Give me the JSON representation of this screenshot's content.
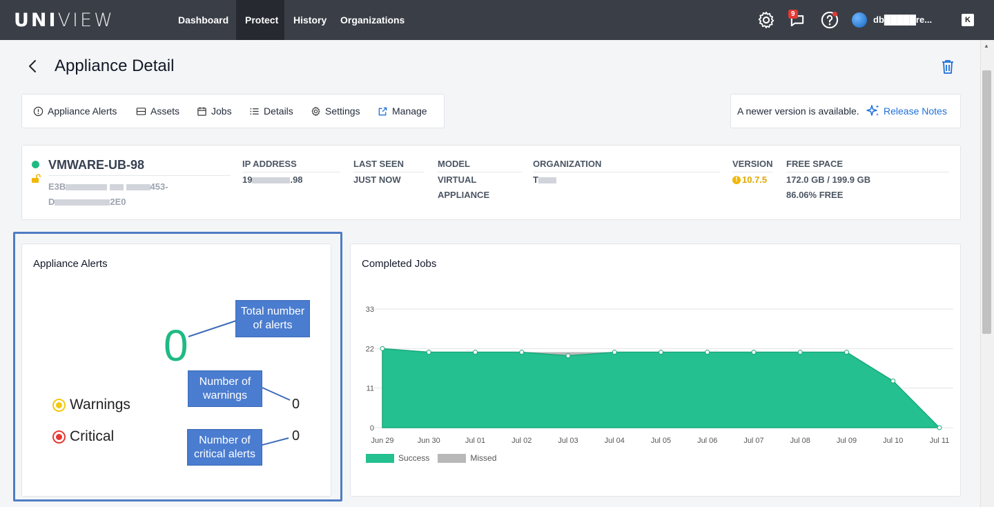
{
  "nav": {
    "logo_bold": "UNI",
    "logo_light": "VIEW",
    "items": [
      "Dashboard",
      "Protect",
      "History",
      "Organizations"
    ],
    "active": "Protect",
    "notifications_count": "9",
    "user": "db█████re..."
  },
  "page": {
    "title": "Appliance Detail"
  },
  "tabs": [
    "Appliance Alerts",
    "Assets",
    "Jobs",
    "Details",
    "Settings",
    "Manage"
  ],
  "release": {
    "text": "A newer version is available.",
    "link": "Release Notes"
  },
  "appliance": {
    "name": "VMWARE-UB-98",
    "id_line1_a": "E3B",
    "id_line1_b": "453-",
    "id_line2_a": "D",
    "id_line2_b": "2E0",
    "ip_label": "IP ADDRESS",
    "ip_a": "19",
    "ip_b": ".98",
    "last_seen_label": "LAST SEEN",
    "last_seen": "JUST NOW",
    "model_label": "MODEL",
    "model_1": "VIRTUAL",
    "model_2": "APPLIANCE",
    "org_label": "ORGANIZATION",
    "org": "T",
    "version_label": "VERSION",
    "version": "10.7.5",
    "free_label": "FREE SPACE",
    "free_1": "172.0 GB / 199.9 GB",
    "free_2": "86.06% FREE"
  },
  "alerts": {
    "title": "Appliance Alerts",
    "total": "0",
    "warnings_label": "Warnings",
    "warnings": "0",
    "critical_label": "Critical",
    "critical": "0",
    "callout_total": "Total number of alerts",
    "callout_warnings": "Number of warnings",
    "callout_critical": "Number of critical alerts",
    "colors": {
      "total": "#1fba83",
      "warning": "#f2c811",
      "critical": "#e53935",
      "callout": "#4a7ccf"
    }
  },
  "jobs": {
    "title": "Completed Jobs",
    "legend_success": "Success",
    "legend_missed": "Missed"
  },
  "chart_data": {
    "type": "area",
    "title": "Completed Jobs",
    "categories": [
      "Jun 29",
      "Jun 30",
      "Jul 01",
      "Jul 02",
      "Jul 03",
      "Jul 04",
      "Jul 05",
      "Jul 06",
      "Jul 07",
      "Jul 08",
      "Jul 09",
      "Jul 10",
      "Jul 11"
    ],
    "series": [
      {
        "name": "Success",
        "color": "#24c08f",
        "values": [
          22,
          21,
          21,
          21,
          20,
          21,
          21,
          21,
          21,
          21,
          21,
          13,
          0
        ]
      },
      {
        "name": "Missed",
        "color": "#b8b8b8",
        "values": [
          0,
          0,
          0,
          0,
          1,
          0,
          0,
          0,
          0,
          0,
          0,
          0,
          0
        ]
      }
    ],
    "stacked": true,
    "yticks": [
      0,
      11,
      22,
      33
    ],
    "ylim": [
      0,
      33
    ],
    "grid": true,
    "legend": "bottom-left"
  }
}
